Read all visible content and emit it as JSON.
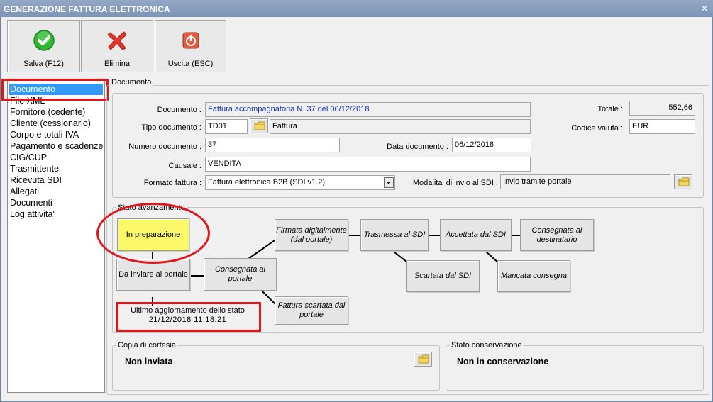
{
  "window": {
    "title": "GENERAZIONE FATTURA ELETTRONICA"
  },
  "toolbar": {
    "save_label": "Salva (F12)",
    "delete_label": "Elimina",
    "exit_label": "Uscita (ESC)"
  },
  "nav": {
    "items": [
      {
        "label": "Documento"
      },
      {
        "label": "File XML"
      },
      {
        "label": "Fornitore (cedente)"
      },
      {
        "label": "Cliente (cessionario)"
      },
      {
        "label": "Corpo e totali IVA"
      },
      {
        "label": "Pagamento e scadenze"
      },
      {
        "label": "CIG/CUP"
      },
      {
        "label": "Trasmittente"
      },
      {
        "label": "Ricevuta SDI"
      },
      {
        "label": "Allegati"
      },
      {
        "label": "Documenti"
      },
      {
        "label": "Log attivita'"
      }
    ]
  },
  "doc": {
    "group_title": "Documento",
    "documento_label": "Documento :",
    "documento_value": "Fattura accompagnatoria N. 37 del 06/12/2018",
    "tipo_label": "Tipo documento :",
    "tipo_code": "TD01",
    "tipo_desc": "Fattura",
    "numero_label": "Numero documento :",
    "numero_value": "37",
    "data_label": "Data documento :",
    "data_value": "06/12/2018",
    "causale_label": "Causale :",
    "causale_value": "VENDITA",
    "formato_label": "Formato fattura :",
    "formato_value": "Fattura elettronica B2B (SDI v1.2)",
    "modalita_label": "Modalita' di invio al SDI :",
    "modalita_value": "Invio tramite portale",
    "totale_label": "Totale :",
    "totale_value": "552,66",
    "valuta_label": "Codice valuta :",
    "valuta_value": "EUR"
  },
  "stato": {
    "group_title": "Stato avanzamento",
    "in_preparazione": "In preparazione",
    "da_inviare": "Da inviare al portale",
    "consegnata_portale": "Consegnata al portale",
    "firmata": "Firmata digitalmente (dal portale)",
    "fattura_scartata": "Fattura scartata dal portale",
    "trasmessa": "Trasmessa al SDI",
    "scartata_sdi": "Scartata dal SDI",
    "accettata": "Accettata dal SDI",
    "mancata": "Mancata consegna",
    "consegnata_dest": "Consegnata al destinatario",
    "ultimo_label": "Ultimo aggiornamento dello stato",
    "ultimo_value": "21/12/2018 11:18:21"
  },
  "cortesia": {
    "group_title": "Copia di cortesia",
    "value": "Non inviata"
  },
  "conservazione": {
    "group_title": "Stato conservazione",
    "value": "Non in conservazione"
  },
  "colors": {
    "accent_red": "#e0161b",
    "selected_blue": "#3399ff",
    "highlight_yellow": "#fbf869"
  }
}
